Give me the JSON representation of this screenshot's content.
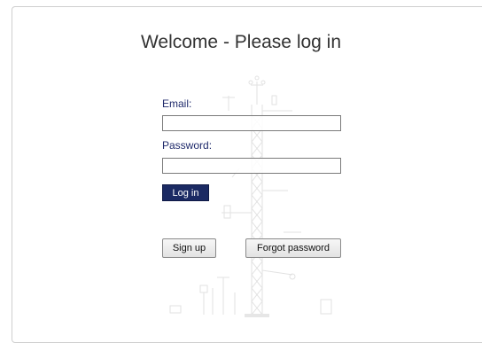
{
  "login": {
    "title": "Welcome - Please log in",
    "email_label": "Email:",
    "email_value": "",
    "password_label": "Password:",
    "password_value": "",
    "login_button": "Log in",
    "signup_button": "Sign up",
    "forgot_button": "Forgot password"
  },
  "theme": {
    "label_color": "#1f2a6b",
    "login_button_color": "#1b2a63",
    "background_art": "weather-station-mast-illustration"
  }
}
